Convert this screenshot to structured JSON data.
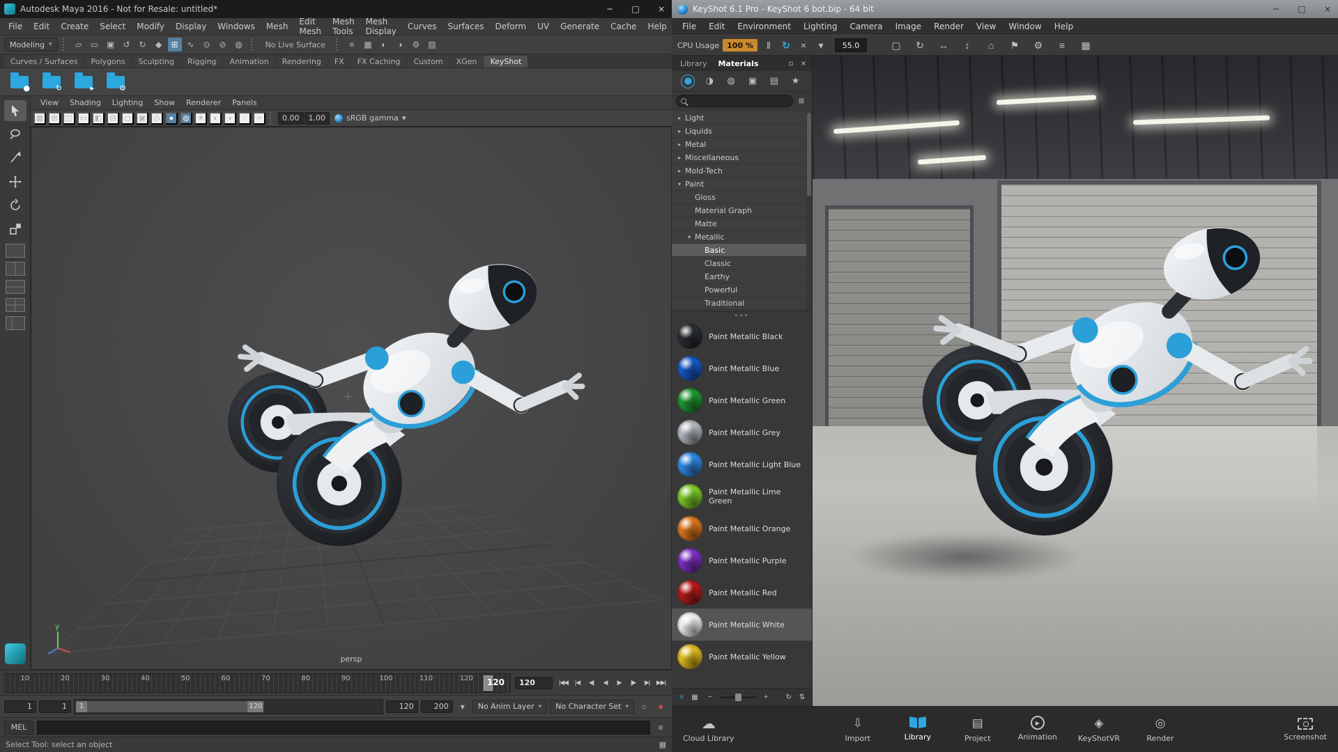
{
  "maya": {
    "window": {
      "title": "Autodesk Maya 2016 - Not for Resale: untitled*",
      "minimize": "─",
      "maximize": "□",
      "close": "×"
    },
    "menus": [
      "File",
      "Edit",
      "Create",
      "Select",
      "Modify",
      "Display",
      "Windows",
      "Mesh",
      "Edit Mesh",
      "Mesh Tools",
      "Mesh Display",
      "Curves",
      "Surfaces",
      "Deform",
      "UV",
      "Generate",
      "Cache",
      "Help"
    ],
    "status_line": {
      "menu_set": "Modeling",
      "dropdown_arrow": "▾",
      "left_icons": [
        {
          "name": "new-scene-icon",
          "glyph": "▱"
        },
        {
          "name": "open-scene-icon",
          "glyph": "▭"
        },
        {
          "name": "save-scene-icon",
          "glyph": "▣"
        },
        {
          "name": "undo-icon",
          "glyph": "↺"
        },
        {
          "name": "redo-icon",
          "glyph": "↻"
        },
        {
          "name": "select-mask-icon",
          "glyph": "◆"
        },
        {
          "name": "snap-to-grid-icon",
          "glyph": "⊞",
          "active": true
        },
        {
          "name": "snap-to-curve-icon",
          "glyph": "∿"
        },
        {
          "name": "snap-to-point-icon",
          "glyph": "⊙"
        },
        {
          "name": "snap-to-plane-icon",
          "glyph": "⊘"
        },
        {
          "name": "make-live-icon",
          "glyph": "◍"
        }
      ],
      "live_surface_label": "No Live Surface",
      "right_icons": [
        {
          "name": "construction-history-icon",
          "glyph": "≡"
        },
        {
          "name": "open-render-view-icon",
          "glyph": "▦"
        },
        {
          "name": "render-current-frame-icon",
          "glyph": "◐"
        },
        {
          "name": "ipr-render-icon",
          "glyph": "◑"
        },
        {
          "name": "render-settings-icon",
          "glyph": "⚙"
        },
        {
          "name": "paint-effects-icon",
          "glyph": "▨"
        }
      ]
    },
    "shelf_tabs": [
      {
        "label": "Curves / Surfaces"
      },
      {
        "label": "Polygons"
      },
      {
        "label": "Sculpting"
      },
      {
        "label": "Rigging"
      },
      {
        "label": "Animation"
      },
      {
        "label": "Rendering"
      },
      {
        "label": "FX"
      },
      {
        "label": "FX Caching"
      },
      {
        "label": "Custom"
      },
      {
        "label": "XGen"
      },
      {
        "label": "KeyShot",
        "active": true
      }
    ],
    "shelf_items": [
      {
        "name": "keyshot-export-button",
        "icon": "keyshot-export-icon",
        "badge": "●"
      },
      {
        "name": "keyshot-update-button",
        "icon": "keyshot-update-icon",
        "badge": "↻"
      },
      {
        "name": "keyshot-open-button",
        "icon": "keyshot-open-icon",
        "badge": "▸"
      },
      {
        "name": "keyshot-settings-button",
        "icon": "keyshot-settings-icon",
        "badge": "⚙"
      }
    ],
    "toolbox": [
      "select-tool-button",
      "lasso-tool-button",
      "paint-select-tool-button",
      "move-tool-button",
      "rotate-tool-button",
      "scale-tool-button"
    ],
    "layouts": [
      "single-pane-layout-button",
      "two-pane-layout-button",
      "two-stacked-layout-button",
      "four-pane-layout-button",
      "outliner-persp-layout-button"
    ],
    "panel_menus": [
      "View",
      "Shading",
      "Lighting",
      "Show",
      "Renderer",
      "Panels"
    ],
    "panel_toolbar": {
      "icons": [
        {
          "name": "select-camera-icon",
          "glyph": "▦"
        },
        {
          "name": "grid-toggle-icon",
          "glyph": "⊞"
        },
        {
          "name": "film-gate-icon",
          "glyph": "◫"
        },
        {
          "name": "resolution-gate-icon",
          "glyph": "▭"
        },
        {
          "name": "gate-mask-icon",
          "glyph": "◧"
        },
        {
          "name": "field-chart-icon",
          "glyph": "⊟"
        },
        {
          "name": "safe-action-icon",
          "glyph": "◻"
        },
        {
          "name": "safe-title-icon",
          "glyph": "▣"
        },
        {
          "name": "wireframe-icon",
          "glyph": "◇"
        },
        {
          "name": "shaded-icon",
          "glyph": "●",
          "active": true
        },
        {
          "name": "textured-icon",
          "glyph": "◍",
          "active": true
        },
        {
          "name": "use-all-lights-icon",
          "glyph": "☀"
        },
        {
          "name": "shadows-icon",
          "glyph": "◗"
        },
        {
          "name": "screen-space-ao-icon",
          "glyph": "◖"
        },
        {
          "name": "motion-blur-icon",
          "glyph": "◌"
        },
        {
          "name": "anti-aliasing-icon",
          "glyph": "≈"
        }
      ],
      "exposure": "0.00",
      "gamma": "1.00",
      "color_mgmt": "sRGB gamma",
      "dropdown_arrow": "▾"
    },
    "viewport": {
      "camera": "persp",
      "axis_y": "y"
    },
    "timeline": {
      "ticks": [
        "10",
        "20",
        "30",
        "40",
        "50",
        "60",
        "70",
        "80",
        "90",
        "100",
        "110",
        "120"
      ],
      "current_frame": "120",
      "current_frame_field": "120",
      "playback": [
        {
          "name": "go-to-start-button",
          "glyph": "|◀◀"
        },
        {
          "name": "step-back-frame-button",
          "glyph": "|◀"
        },
        {
          "name": "step-back-key-button",
          "glyph": "◀|"
        },
        {
          "name": "play-backwards-button",
          "glyph": "◀"
        },
        {
          "name": "play-forwards-button",
          "glyph": "▶"
        },
        {
          "name": "step-forward-key-button",
          "glyph": "|▶"
        },
        {
          "name": "step-forward-frame-button",
          "glyph": "▶|"
        },
        {
          "name": "go-to-end-button",
          "glyph": "▶▶|"
        }
      ]
    },
    "range_bar": {
      "anim_start": "1",
      "playback_start": "1",
      "range_start": "1",
      "range_end": "120",
      "playback_end": "120",
      "anim_end": "200",
      "options_glyph": "▾",
      "dd_arrow": "▾",
      "anim_layer": "No Anim Layer",
      "character_set": "No Character Set",
      "mute_glyph": "○",
      "autokey_glyph": "●"
    },
    "command_line": {
      "label": "MEL",
      "value": "",
      "icon_glyph": "≡"
    },
    "help_line": {
      "text": "Select Tool: select an object",
      "grid_glyph": "▦"
    }
  },
  "keyshot": {
    "window": {
      "title": "KeyShot 6.1 Pro - KeyShot 6 bot.bip  - 64 bit",
      "minimize": "─",
      "maximize": "□",
      "close": "×"
    },
    "menus": [
      "File",
      "Edit",
      "Environment",
      "Lighting",
      "Camera",
      "Image",
      "Render",
      "View",
      "Window",
      "Help"
    ],
    "toolbar": {
      "cpu_label": "CPU Usage",
      "cpu_value": "100 %",
      "left_icons": [
        {
          "name": "pause-realtime-icon",
          "glyph": "‖"
        },
        {
          "name": "update-realtime-icon",
          "glyph": "↻",
          "active": true
        },
        {
          "name": "stop-render-icon",
          "glyph": "×"
        },
        {
          "name": "performance-dropdown-icon",
          "glyph": "▾"
        }
      ],
      "focal_value": "55.0",
      "right_icons": [
        {
          "name": "region-render-icon",
          "glyph": "▢"
        },
        {
          "name": "orbit-camera-icon",
          "glyph": "↻"
        },
        {
          "name": "pan-camera-icon",
          "glyph": "↔"
        },
        {
          "name": "dolly-camera-icon",
          "glyph": "↕"
        },
        {
          "name": "home-camera-icon",
          "glyph": "⌂"
        },
        {
          "name": "flag-icon",
          "glyph": "⚑"
        },
        {
          "name": "settings-icon",
          "glyph": "⚙"
        },
        {
          "name": "render-queue-icon",
          "glyph": "≡"
        },
        {
          "name": "image-export-icon",
          "glyph": "▦"
        }
      ]
    },
    "library": {
      "tabs": [
        {
          "label": "Library"
        },
        {
          "label": "Materials",
          "active": true
        }
      ],
      "detach_icon": "▫",
      "close_icon": "×",
      "category_icons": [
        {
          "name": "materials-category-icon",
          "glyph": "●",
          "active": true
        },
        {
          "name": "colors-category-icon",
          "glyph": "◑"
        },
        {
          "name": "environments-category-icon",
          "glyph": "◍"
        },
        {
          "name": "backplates-category-icon",
          "glyph": "▣"
        },
        {
          "name": "textures-category-icon",
          "glyph": "▤"
        },
        {
          "name": "favorites-category-icon",
          "glyph": "★"
        }
      ],
      "search_placeholder": "",
      "search_icons": [
        {
          "name": "add-folder-icon",
          "glyph": "⊞"
        },
        {
          "name": "import-library-icon",
          "glyph": "⇩"
        },
        {
          "name": "refresh-library-icon",
          "glyph": "↻"
        }
      ],
      "tree": [
        {
          "label": "Light",
          "arrow": "▸",
          "indent": 1
        },
        {
          "label": "Liquids",
          "arrow": "▸",
          "indent": 1
        },
        {
          "label": "Metal",
          "arrow": "▸",
          "indent": 1
        },
        {
          "label": "Miscellaneous",
          "arrow": "▸",
          "indent": 1
        },
        {
          "label": "Mold-Tech",
          "arrow": "▸",
          "indent": 1
        },
        {
          "label": "Paint",
          "arrow": "▾",
          "indent": 1
        },
        {
          "label": "Gloss",
          "arrow": "",
          "indent": 2
        },
        {
          "label": "Material Graph",
          "arrow": "",
          "indent": 2
        },
        {
          "label": "Matte",
          "arrow": "",
          "indent": 2
        },
        {
          "label": "Metallic",
          "arrow": "▾",
          "indent": 2
        },
        {
          "label": "Basic",
          "arrow": "",
          "indent": 3,
          "selected": true
        },
        {
          "label": "Classic",
          "arrow": "",
          "indent": 3
        },
        {
          "label": "Earthy",
          "arrow": "",
          "indent": 3
        },
        {
          "label": "Powerful",
          "arrow": "",
          "indent": 3
        },
        {
          "label": "Traditional",
          "arrow": "",
          "indent": 3
        }
      ],
      "splitter_dots": "•••",
      "materials": [
        {
          "label": "Paint Metallic Black",
          "color": "#2a2d31"
        },
        {
          "label": "Paint Metallic Blue",
          "color": "#1758c4"
        },
        {
          "label": "Paint Metallic Green",
          "color": "#1f9432"
        },
        {
          "label": "Paint Metallic Grey",
          "color": "#aeb4ba"
        },
        {
          "label": "Paint Metallic Light Blue",
          "color": "#2f86e0"
        },
        {
          "label": "Paint Metallic Lime Green",
          "color": "#7cc62a"
        },
        {
          "label": "Paint Metallic Orange",
          "color": "#d8751c"
        },
        {
          "label": "Paint Metallic Purple",
          "color": "#7d2fc0"
        },
        {
          "label": "Paint Metallic Red",
          "color": "#b51a1a"
        },
        {
          "label": "Paint Metallic White",
          "color": "#e9ecee",
          "selected": true
        },
        {
          "label": "Paint Metallic Yellow",
          "color": "#dcb91e"
        }
      ],
      "footer": {
        "view_icons": [
          {
            "name": "list-view-icon",
            "glyph": "≡",
            "active": true
          },
          {
            "name": "thumbnail-view-icon",
            "glyph": "▦"
          }
        ],
        "zoom_out_glyph": "−",
        "zoom_in_glyph": "+",
        "right_icons": [
          {
            "name": "sync-library-icon",
            "glyph": "↻"
          },
          {
            "name": "upload-library-icon",
            "glyph": "⇅"
          }
        ]
      }
    },
    "dock": {
      "cloud": {
        "label": "Cloud Library",
        "icon": "cloud-icon",
        "glyph": "☁"
      },
      "items": [
        {
          "label": "Import",
          "name": "dock-import",
          "icon": "import-icon",
          "glyph": "⇩"
        },
        {
          "label": "Library",
          "name": "dock-library",
          "icon": "library-icon",
          "glyph": "",
          "active": true
        },
        {
          "label": "Project",
          "name": "dock-project",
          "icon": "project-icon",
          "glyph": "▤"
        },
        {
          "label": "Animation",
          "name": "dock-animation",
          "icon": "animation-icon",
          "glyph": "▶"
        },
        {
          "label": "KeyShotVR",
          "name": "dock-keyshotvr",
          "icon": "keyshotvr-icon",
          "glyph": "◈"
        },
        {
          "label": "Render",
          "name": "dock-render",
          "icon": "render-icon",
          "glyph": "◎"
        }
      ],
      "screenshot": {
        "label": "Screenshot",
        "icon": "screenshot-icon",
        "glyph": ""
      }
    },
    "colors": {
      "accent": "#2da7e0",
      "cpu_badge": "#c98a2e"
    }
  }
}
